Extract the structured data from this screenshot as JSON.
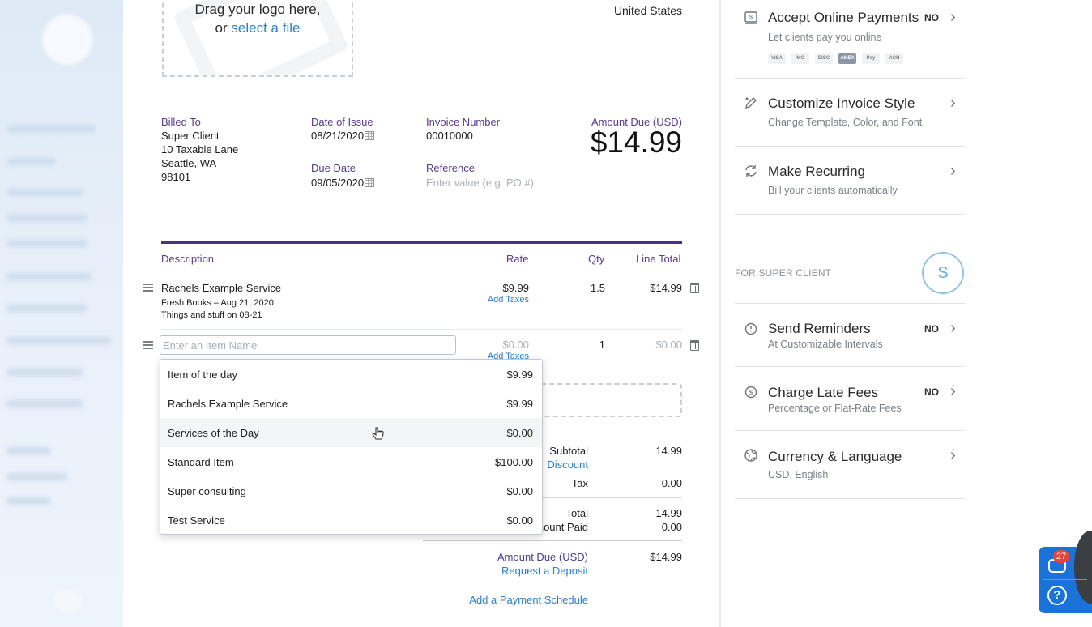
{
  "logo": {
    "line1": "Drag your logo here,",
    "line2_prefix": "or",
    "line2_link": "select a file"
  },
  "from": {
    "country": "United States"
  },
  "billed_to": {
    "label": "Billed To",
    "lines": [
      "Super Client",
      "10 Taxable Lane",
      "Seattle, WA",
      "98101"
    ]
  },
  "dates": {
    "issue_label": "Date of Issue",
    "issue_value": "08/21/2020",
    "due_label": "Due Date",
    "due_value": "09/05/2020"
  },
  "invoice": {
    "number_label": "Invoice Number",
    "number_value": "00010000",
    "reference_label": "Reference",
    "reference_placeholder": "Enter value (e.g. PO #)",
    "amount_due_label": "Amount Due (USD)",
    "amount_due_value": "$14.99"
  },
  "table": {
    "headers": {
      "description": "Description",
      "rate": "Rate",
      "qty": "Qty",
      "line_total": "Line Total"
    },
    "rows": [
      {
        "name": "Rachels Example Service",
        "desc1": "Fresh Books – Aug 21, 2020",
        "desc2": "Things and stuff on 08-21",
        "rate": "$9.99",
        "add_taxes": "Add Taxes",
        "qty": "1.5",
        "total": "$14.99"
      }
    ],
    "new_row": {
      "placeholder": "Enter an Item Name",
      "rate": "$0.00",
      "add_taxes": "Add Taxes",
      "qty": "1",
      "total": "$0.00"
    }
  },
  "dropdown": {
    "items": [
      {
        "name": "Item of the day",
        "price": "$9.99"
      },
      {
        "name": "Rachels Example Service",
        "price": "$9.99"
      },
      {
        "name": "Services of the Day",
        "price": "$0.00"
      },
      {
        "name": "Standard Item",
        "price": "$100.00"
      },
      {
        "name": "Super consulting",
        "price": "$0.00"
      },
      {
        "name": "Test Service",
        "price": "$0.00"
      }
    ]
  },
  "totals": {
    "subtotal_label": "Subtotal",
    "subtotal_value": "14.99",
    "discount_link": "Discount",
    "tax_label": "Tax",
    "tax_value": "0.00",
    "total_label": "Total",
    "total_value": "14.99",
    "amount_paid_label": "Amount Paid",
    "amount_paid_value": "0.00",
    "amount_due_label": "Amount Due (USD)",
    "amount_due_value": "$14.99",
    "request_deposit": "Request a Deposit",
    "payment_schedule": "Add a Payment Schedule"
  },
  "right_panel": {
    "accept_payments": {
      "title": "Accept Online Payments",
      "sub": "Let clients pay you online",
      "status": "NO",
      "cards": [
        "VISA",
        "MC",
        "DISC",
        "AMEX",
        "Pay",
        "ACH"
      ]
    },
    "customize": {
      "title": "Customize Invoice Style",
      "sub": "Change Template, Color, and Font"
    },
    "recurring": {
      "title": "Make Recurring",
      "sub": "Bill your clients automatically"
    },
    "for_client_label": "FOR SUPER CLIENT",
    "client_initial": "S",
    "reminders": {
      "title": "Send Reminders",
      "sub": "At Customizable Intervals",
      "status": "NO"
    },
    "late_fees": {
      "title": "Charge Late Fees",
      "sub": "Percentage or Flat-Rate Fees",
      "status": "NO"
    },
    "currency": {
      "title": "Currency & Language",
      "sub": "USD, English"
    }
  },
  "help_widget": {
    "badge_count": "27"
  }
}
